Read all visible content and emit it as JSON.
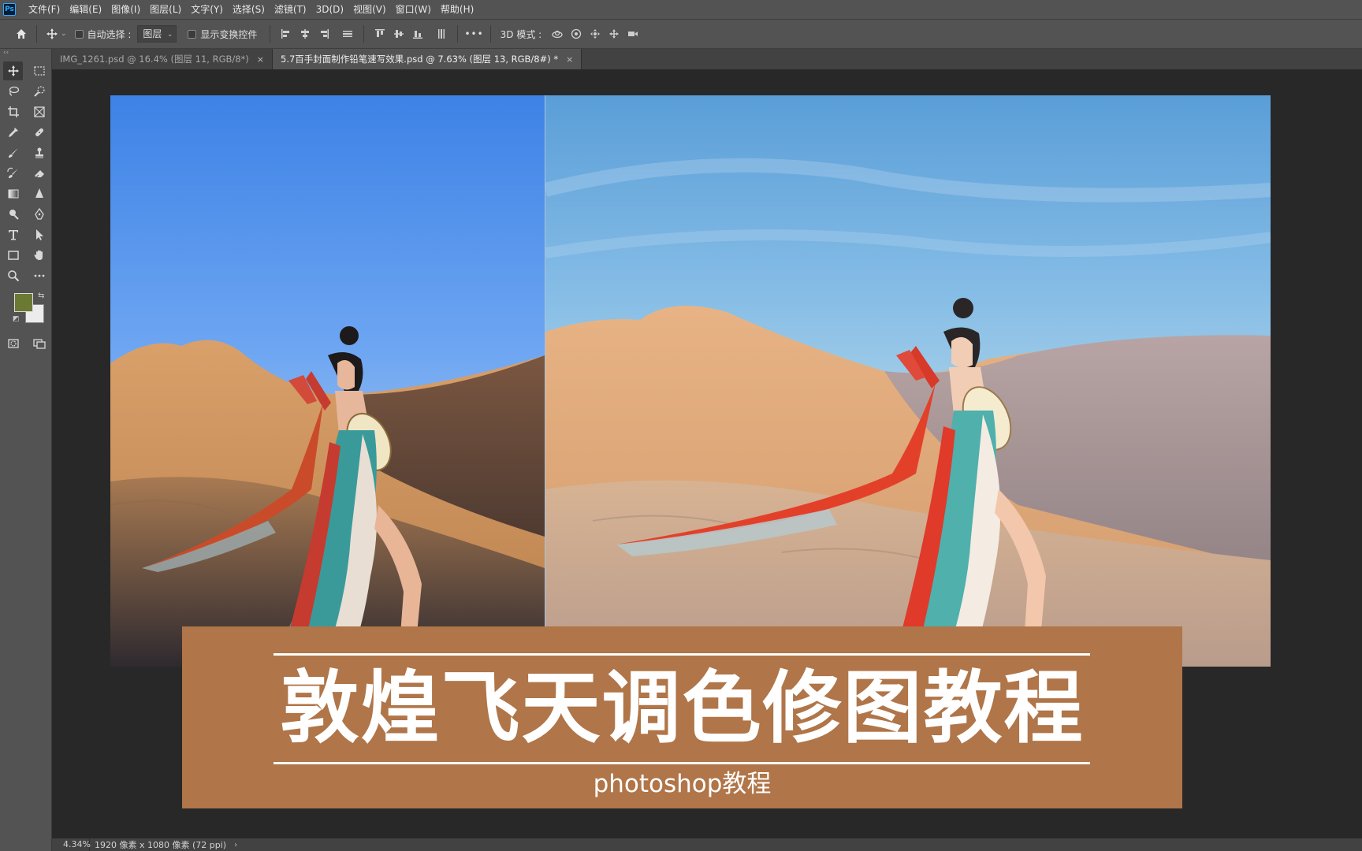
{
  "app": {
    "logo": "Ps"
  },
  "menu": [
    "文件(F)",
    "编辑(E)",
    "图像(I)",
    "图层(L)",
    "文字(Y)",
    "选择(S)",
    "滤镜(T)",
    "3D(D)",
    "视图(V)",
    "窗口(W)",
    "帮助(H)"
  ],
  "options": {
    "auto_select_label": "自动选择 :",
    "auto_select_value": "图层",
    "show_transform_label": "显示变换控件",
    "more_label": "•••",
    "mode_3d_label": "3D 模式 :"
  },
  "tabs": [
    {
      "label": "IMG_1261.psd @ 16.4% (图层 11, RGB/8*)",
      "close": "×",
      "active": false
    },
    {
      "label": "5.7百手封面制作铅笔速写效果.psd @ 7.63% (图层 13, RGB/8#) *",
      "close": "×",
      "active": true
    }
  ],
  "toolbar": {
    "collapse": "‹‹",
    "foreground_color": "#6b7a32",
    "background_color": "#ececec",
    "tools": [
      "move-tool",
      "marquee-tool",
      "lasso-tool",
      "quick-select-tool",
      "crop-tool",
      "frame-tool",
      "eyedropper-tool",
      "healing-brush-tool",
      "brush-tool",
      "clone-stamp-tool",
      "history-brush-tool",
      "eraser-tool",
      "gradient-tool",
      "blur-tool",
      "dodge-tool",
      "pen-tool",
      "type-tool",
      "path-select-tool",
      "rectangle-tool",
      "hand-tool",
      "zoom-tool",
      "more-tools"
    ]
  },
  "banner": {
    "title": "敦煌飞天调色修图教程",
    "subtitle": "photoshop教程",
    "color": "#b07548"
  },
  "status": {
    "zoom": "4.34%",
    "doc_info": "1920 像素 x 1080 像素 (72 ppi)",
    "arrow": "›"
  }
}
